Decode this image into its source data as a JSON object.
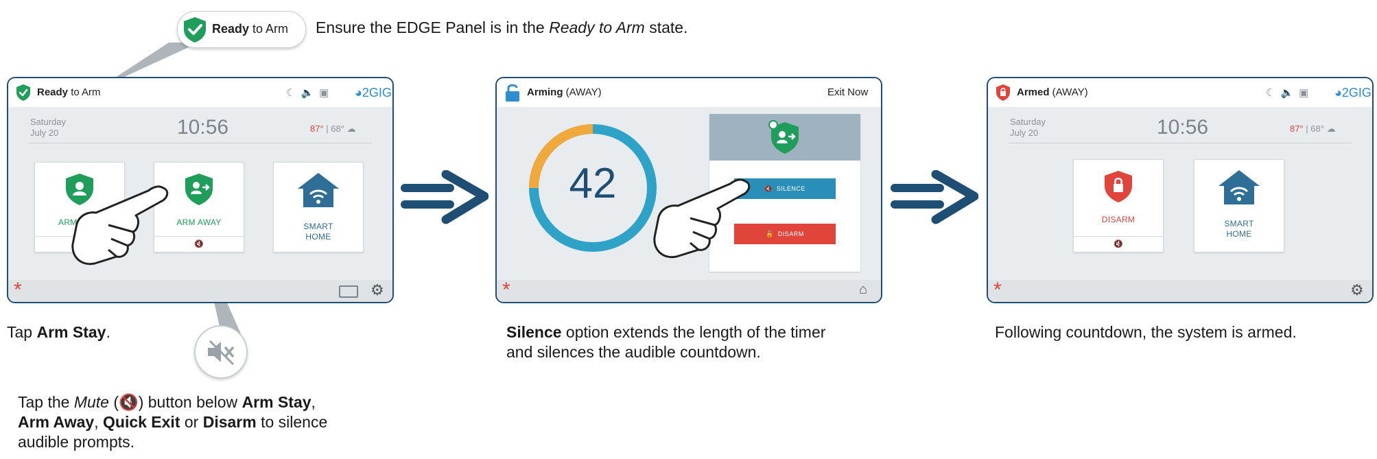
{
  "callout": {
    "status_bold": "Ready",
    "status_rest": " to Arm",
    "text_before": "Ensure the EDGE Panel is in the ",
    "text_italic": "Ready to Arm",
    "text_after": " state."
  },
  "screen1": {
    "status_bold": "Ready",
    "status_rest": " to Arm",
    "brand": "2GIG",
    "day": "Saturday",
    "date": "July 20",
    "time": "10:56",
    "temp_hi": "87°",
    "temp_sep": " | ",
    "temp_lo": "68°",
    "tiles": [
      {
        "label": "ARM STAY"
      },
      {
        "label": "ARM AWAY"
      },
      {
        "label": "SMART\nHOME"
      }
    ]
  },
  "screen2": {
    "status_bold": "Arming",
    "status_rest": " (AWAY)",
    "exit_now": "Exit Now",
    "countdown": "42",
    "silence_label": "SILENCE",
    "disarm_label": "DISARM"
  },
  "screen3": {
    "status_bold": "Armed",
    "status_rest": " (AWAY)",
    "brand": "2GIG",
    "day": "Saturday",
    "date": "July 20",
    "time": "10:56",
    "temp_hi": "87°",
    "temp_sep": " | ",
    "temp_lo": "68°",
    "tiles": [
      {
        "label": "DISARM"
      },
      {
        "label": "SMART\nHOME"
      }
    ]
  },
  "captions": {
    "c1_pre": "Tap ",
    "c1_bold": "Arm Stay",
    "c1_post": ".",
    "c2_bold": "Silence",
    "c2_line1_rest": " option extends the length of the timer",
    "c2_line2": "and silences the audible countdown.",
    "c3": "Following countdown, the system is armed.",
    "mute_pre": "Tap the ",
    "mute_italic": "Mute",
    "mute_paren_open": " (",
    "mute_paren_close": ") button below ",
    "mute_b1": "Arm Stay",
    "mute_sep1": ",",
    "mute_b2": "Arm Away",
    "mute_sep2": ", ",
    "mute_b3": "Quick Exit",
    "mute_sep3": " or ",
    "mute_b4": "Disarm",
    "mute_post1": " to silence",
    "mute_line3": "audible prompts."
  },
  "colors": {
    "green": "#1e9e5a",
    "red": "#e0443b",
    "blue_arrow": "#1e4e73",
    "silence_btn": "#2a8fb8",
    "ring_blue": "#2ea3c7",
    "ring_orange": "#f0a93a"
  }
}
